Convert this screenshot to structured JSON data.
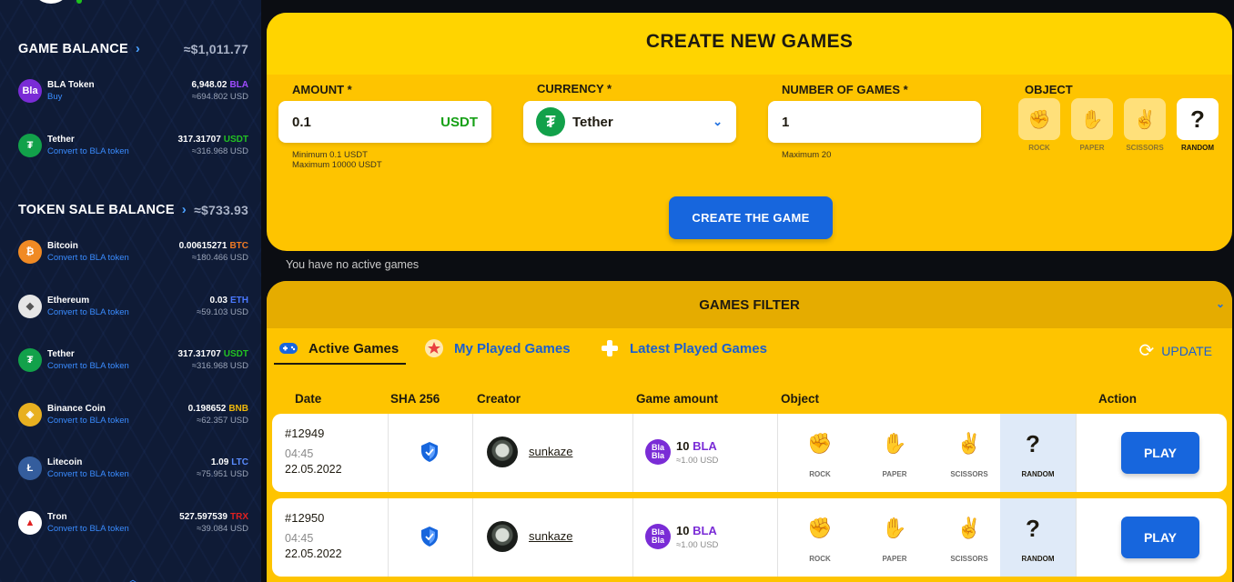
{
  "sidebar": {
    "game_balance": {
      "label": "GAME BALANCE",
      "total": "≈$1,011.77"
    },
    "game_coins": [
      {
        "icon": "bla-token-icon",
        "symbol_icon": "Bla",
        "color": "#7a2cd6",
        "name": "BLA Token",
        "sub": "Buy",
        "amount": "6,948.02",
        "currency": "BLA",
        "currency_color": "#a04cff",
        "usd": "≈694.802 USD"
      },
      {
        "icon": "tether-icon",
        "symbol_icon": "₮",
        "color": "#12a14a",
        "name": "Tether",
        "sub": "Convert to BLA token",
        "amount": "317.31707",
        "currency": "USDT",
        "currency_color": "#22c322",
        "usd": "≈316.968 USD"
      }
    ],
    "token_sale_balance": {
      "label": "TOKEN SALE BALANCE",
      "total": "≈$733.93"
    },
    "sale_coins": [
      {
        "icon": "bitcoin-icon",
        "symbol_icon": "₿",
        "color": "#f08a24",
        "name": "Bitcoin",
        "sub": "Convert to BLA token",
        "amount": "0.00615271",
        "currency": "BTC",
        "currency_color": "#f07a24",
        "usd": "≈180.466 USD"
      },
      {
        "icon": "ethereum-icon",
        "symbol_icon": "◆",
        "color": "#e6e6e6",
        "name": "Ethereum",
        "sub": "Convert to BLA token",
        "amount": "0.03",
        "currency": "ETH",
        "currency_color": "#4a78ff",
        "usd": "≈59.103 USD"
      },
      {
        "icon": "tether-icon",
        "symbol_icon": "₮",
        "color": "#12a14a",
        "name": "Tether",
        "sub": "Convert to BLA token",
        "amount": "317.31707",
        "currency": "USDT",
        "currency_color": "#22c322",
        "usd": "≈316.968 USD"
      },
      {
        "icon": "binance-coin-icon",
        "symbol_icon": "◈",
        "color": "#e8b020",
        "name": "Binance Coin",
        "sub": "Convert to BLA token",
        "amount": "0.198652",
        "currency": "BNB",
        "currency_color": "#f0b90b",
        "usd": "≈62.357 USD"
      },
      {
        "icon": "litecoin-icon",
        "symbol_icon": "Ł",
        "color": "#345d9d",
        "name": "Litecoin",
        "sub": "Convert to BLA token",
        "amount": "1.09",
        "currency": "LTC",
        "currency_color": "#5a8cff",
        "usd": "≈75.951 USD"
      },
      {
        "icon": "tron-icon",
        "symbol_icon": "▲",
        "color": "#ffffff",
        "name": "Tron",
        "sub": "Convert to BLA token",
        "amount": "527.597539",
        "currency": "TRX",
        "currency_color": "#e02020",
        "usd": "≈39.084 USD"
      }
    ]
  },
  "create": {
    "title": "CREATE NEW GAMES",
    "amount_label": "AMOUNT *",
    "amount_value": "0.1",
    "amount_currency": "USDT",
    "amount_min": "Minimum 0.1 USDT",
    "amount_max": "Maximum 10000 USDT",
    "currency_label": "CURRENCY *",
    "currency_value": "Tether",
    "games_label": "NUMBER OF GAMES *",
    "games_value": "1",
    "games_max": "Maximum 20",
    "object_label": "OBJECT",
    "objects": [
      {
        "label": "ROCK",
        "icon": "rock-hand-icon",
        "glyph": "✊",
        "selected": false
      },
      {
        "label": "PAPER",
        "icon": "paper-hand-icon",
        "glyph": "✋",
        "selected": false
      },
      {
        "label": "SCISSORS",
        "icon": "scissors-hand-icon",
        "glyph": "✌",
        "selected": false
      },
      {
        "label": "RANDOM",
        "icon": "question-mark-icon",
        "glyph": "?",
        "selected": true
      }
    ],
    "button": "CREATE THE GAME"
  },
  "no_active": "You have no active games",
  "filter": {
    "title": "GAMES FILTER",
    "tabs": [
      {
        "label": "Active Games",
        "icon": "gamepad-icon",
        "active": true
      },
      {
        "label": "My Played Games",
        "icon": "star-icon",
        "active": false
      },
      {
        "label": "Latest Played Games",
        "icon": "dpad-icon",
        "active": false
      }
    ],
    "update": "UPDATE",
    "headers": [
      "Date",
      "SHA 256",
      "Creator",
      "Game amount",
      "Object",
      "Action"
    ],
    "rows": [
      {
        "id": "#12949",
        "time": "04:45",
        "date": "22.05.2022",
        "creator": "sunkaze",
        "amount": "10",
        "currency": "BLA",
        "usd": "≈1.00 USD",
        "objects": [
          "ROCK",
          "PAPER",
          "SCISSORS",
          "RANDOM"
        ],
        "action": "PLAY"
      },
      {
        "id": "#12950",
        "time": "04:45",
        "date": "22.05.2022",
        "creator": "sunkaze",
        "amount": "10",
        "currency": "BLA",
        "usd": "≈1.00 USD",
        "objects": [
          "ROCK",
          "PAPER",
          "SCISSORS",
          "RANDOM"
        ],
        "action": "PLAY"
      }
    ]
  }
}
